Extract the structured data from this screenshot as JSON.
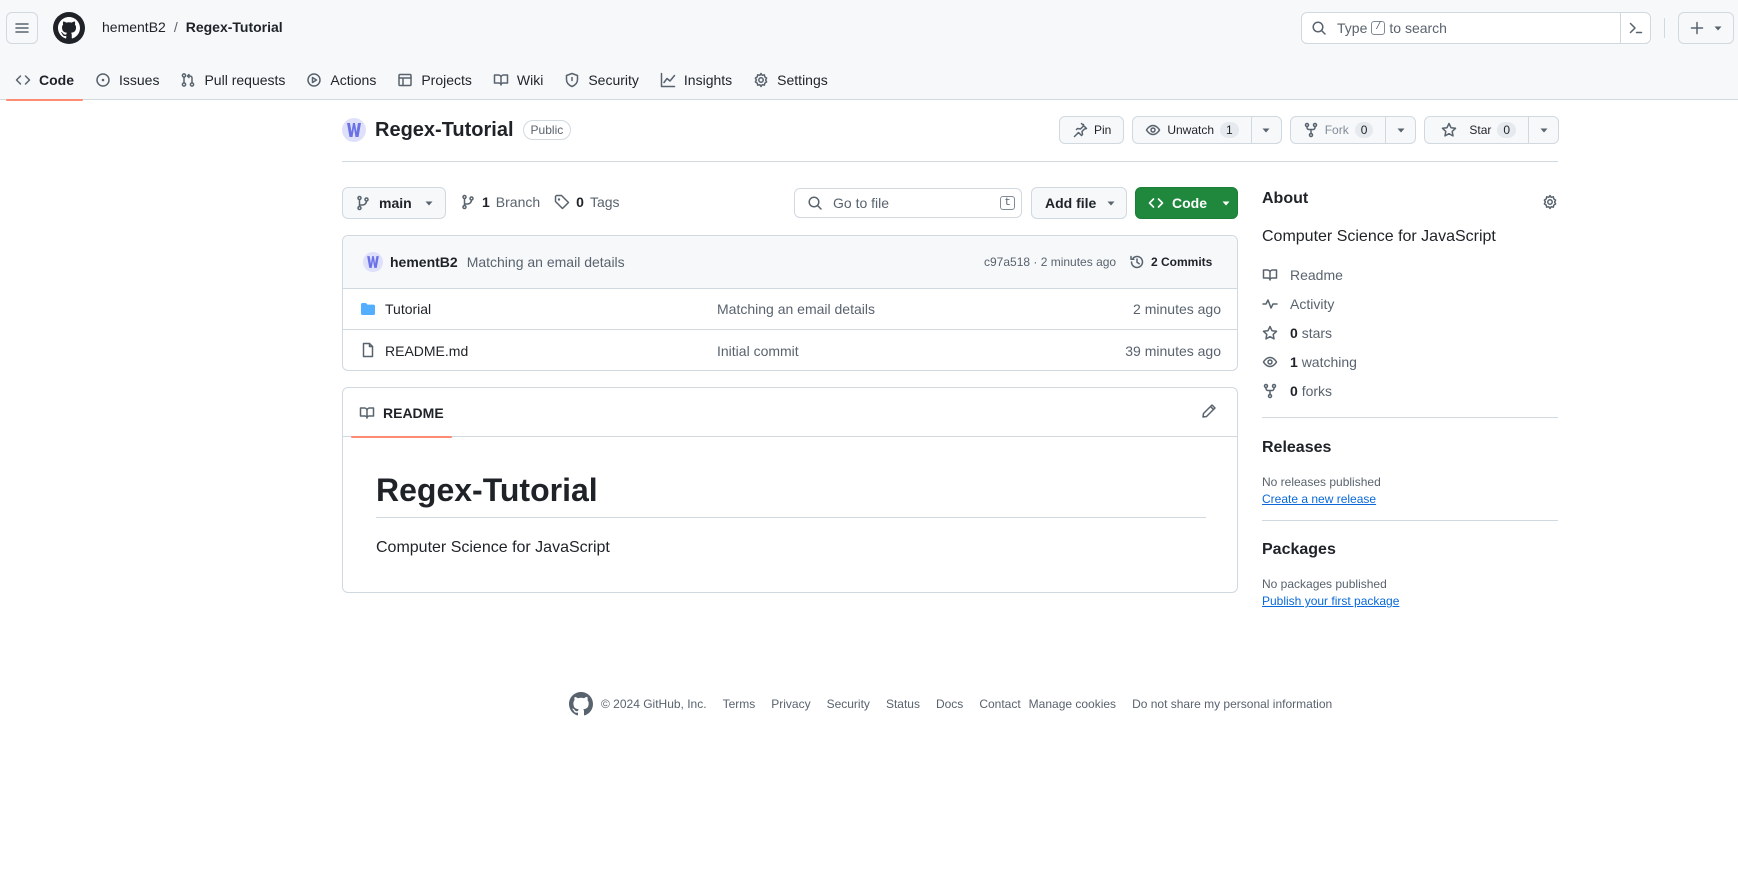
{
  "header": {
    "owner": "hementB2",
    "separator": "/",
    "repo": "Regex-Tutorial",
    "search": {
      "before": "Type",
      "key": "/",
      "after": "to search"
    },
    "tabs": [
      {
        "label": "Code",
        "icon": "code-icon",
        "active": true
      },
      {
        "label": "Issues",
        "icon": "issue-icon"
      },
      {
        "label": "Pull requests",
        "icon": "pull-request-icon"
      },
      {
        "label": "Actions",
        "icon": "play-icon"
      },
      {
        "label": "Projects",
        "icon": "table-icon"
      },
      {
        "label": "Wiki",
        "icon": "book-icon"
      },
      {
        "label": "Security",
        "icon": "shield-icon"
      },
      {
        "label": "Insights",
        "icon": "graph-icon"
      },
      {
        "label": "Settings",
        "icon": "gear-icon"
      }
    ]
  },
  "repo": {
    "name": "Regex-Tutorial",
    "visibility": "Public",
    "pin_label": "Pin",
    "unwatch_label": "Unwatch",
    "watch_count": "1",
    "fork_label": "Fork",
    "fork_count": "0",
    "star_label": "Star",
    "star_count": "0"
  },
  "toolbar": {
    "branch": "main",
    "branch_count": "1",
    "branch_label": "Branch",
    "tag_count": "0",
    "tag_label": "Tags",
    "goto_placeholder": "Go to file",
    "goto_key": "t",
    "add_file_label": "Add file",
    "code_label": "Code"
  },
  "commit": {
    "author": "hementB2",
    "message": "Matching an email details",
    "sha_age": "c97a518 · 2 minutes ago",
    "commits_label": "2 Commits"
  },
  "files": [
    {
      "name": "Tutorial",
      "type": "folder",
      "message": "Matching an email details",
      "age": "2 minutes ago"
    },
    {
      "name": "README.md",
      "type": "file",
      "message": "Initial commit",
      "age": "39 minutes ago"
    }
  ],
  "readme": {
    "tab_label": "README",
    "heading": "Regex-Tutorial",
    "body": "Computer Science for JavaScript"
  },
  "about": {
    "title": "About",
    "description": "Computer Science for JavaScript",
    "readme_label": "Readme",
    "activity_label": "Activity",
    "stars_count": "0",
    "stars_label": "stars",
    "watching_count": "1",
    "watching_label": "watching",
    "forks_count": "0",
    "forks_label": "forks"
  },
  "releases": {
    "title": "Releases",
    "empty": "No releases published",
    "link": "Create a new release"
  },
  "packages": {
    "title": "Packages",
    "empty": "No packages published",
    "link": "Publish your first package"
  },
  "footer": {
    "copyright": "© 2024 GitHub, Inc.",
    "links": [
      "Terms",
      "Privacy",
      "Security",
      "Status",
      "Docs",
      "Contact",
      "Manage cookies",
      "Do not share my personal information"
    ]
  },
  "colors": {
    "accent_green": "#1f883d",
    "link_blue": "#0969da",
    "tab_underline": "#fd8c73",
    "folder_blue": "#54aeff"
  }
}
